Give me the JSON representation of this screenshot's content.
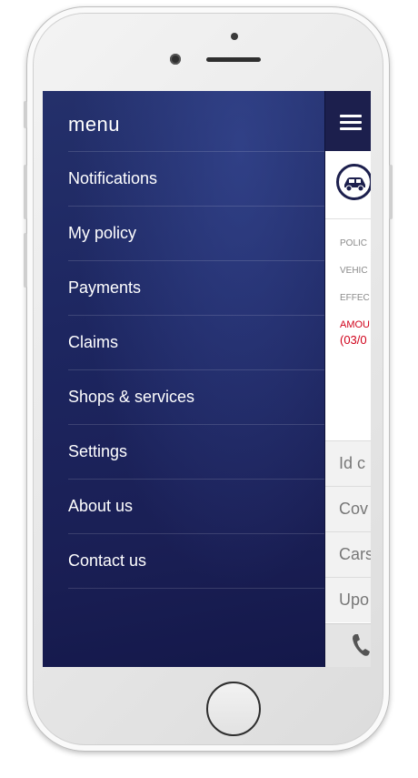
{
  "menu": {
    "title": "menu",
    "items": [
      {
        "label": "Notifications"
      },
      {
        "label": "My policy"
      },
      {
        "label": "Payments"
      },
      {
        "label": "Claims"
      },
      {
        "label": "Shops & services"
      },
      {
        "label": "Settings"
      },
      {
        "label": "About us"
      },
      {
        "label": "Contact us"
      }
    ]
  },
  "app": {
    "header_icon": "hamburger-menu-icon",
    "badge_icon": "car-icon",
    "fields": {
      "policy": "POLIC",
      "vehicle": "VEHIC",
      "effective": "EFFEC",
      "amount": "AMOU",
      "amount_date": "(03/0"
    },
    "rows": [
      {
        "label": "Id c"
      },
      {
        "label": "Cov"
      },
      {
        "label": "Cars"
      },
      {
        "label": "Upo"
      }
    ],
    "bottom_icon": "phone-icon"
  },
  "colors": {
    "menu_bg": "#1d2660",
    "header_bg": "#1c1f4d",
    "accent_red": "#d0021b"
  }
}
